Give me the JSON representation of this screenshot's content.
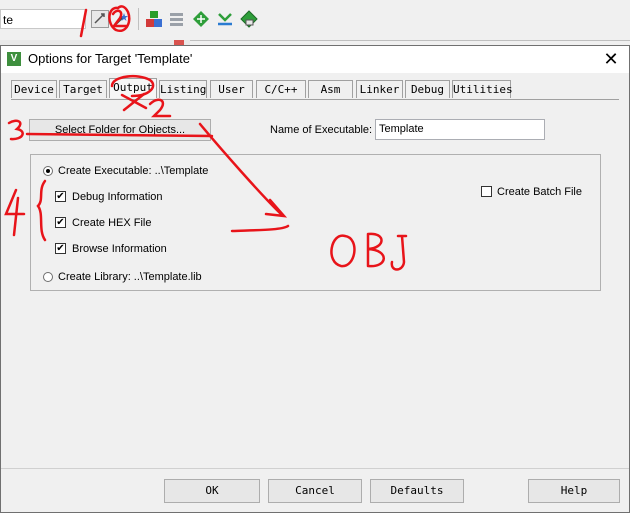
{
  "toolbar": {
    "combo_value": "te",
    "icons": [
      "target-options-icon",
      "wand-icon",
      "manage-components-icon",
      "stack-icon",
      "green-diamond-icon",
      "download-icon",
      "flash-icon"
    ]
  },
  "dialog": {
    "title": "Options for Target 'Template'",
    "icon_letter": "V",
    "close": "✕",
    "tabs": [
      "Device",
      "Target",
      "Output",
      "Listing",
      "User",
      "C/C++",
      "Asm",
      "Linker",
      "Debug",
      "Utilities"
    ],
    "active_tab": "Output",
    "select_folder_label": "Select Folder for Objects...",
    "name_label": "Name of Executable:",
    "name_value": "Template",
    "create_executable_label": "Create Executable:  ..\\Template",
    "debug_info_label": "Debug Information",
    "create_hex_label": "Create HEX File",
    "browse_info_label": "Browse Information",
    "create_library_label": "Create Library:  ..\\Template.lib",
    "create_batch_label": "Create Batch File",
    "buttons": {
      "ok": "OK",
      "cancel": "Cancel",
      "defaults": "Defaults",
      "help": "Help"
    }
  },
  "states": {
    "create_executable_selected": true,
    "debug_info_checked": true,
    "create_hex_checked": true,
    "browse_info_checked": true,
    "create_library_selected": false,
    "create_batch_checked": false
  },
  "annotations": {
    "color": "#e8141a",
    "texts": [
      "1",
      "2",
      "3",
      "4",
      "OBJ"
    ]
  }
}
